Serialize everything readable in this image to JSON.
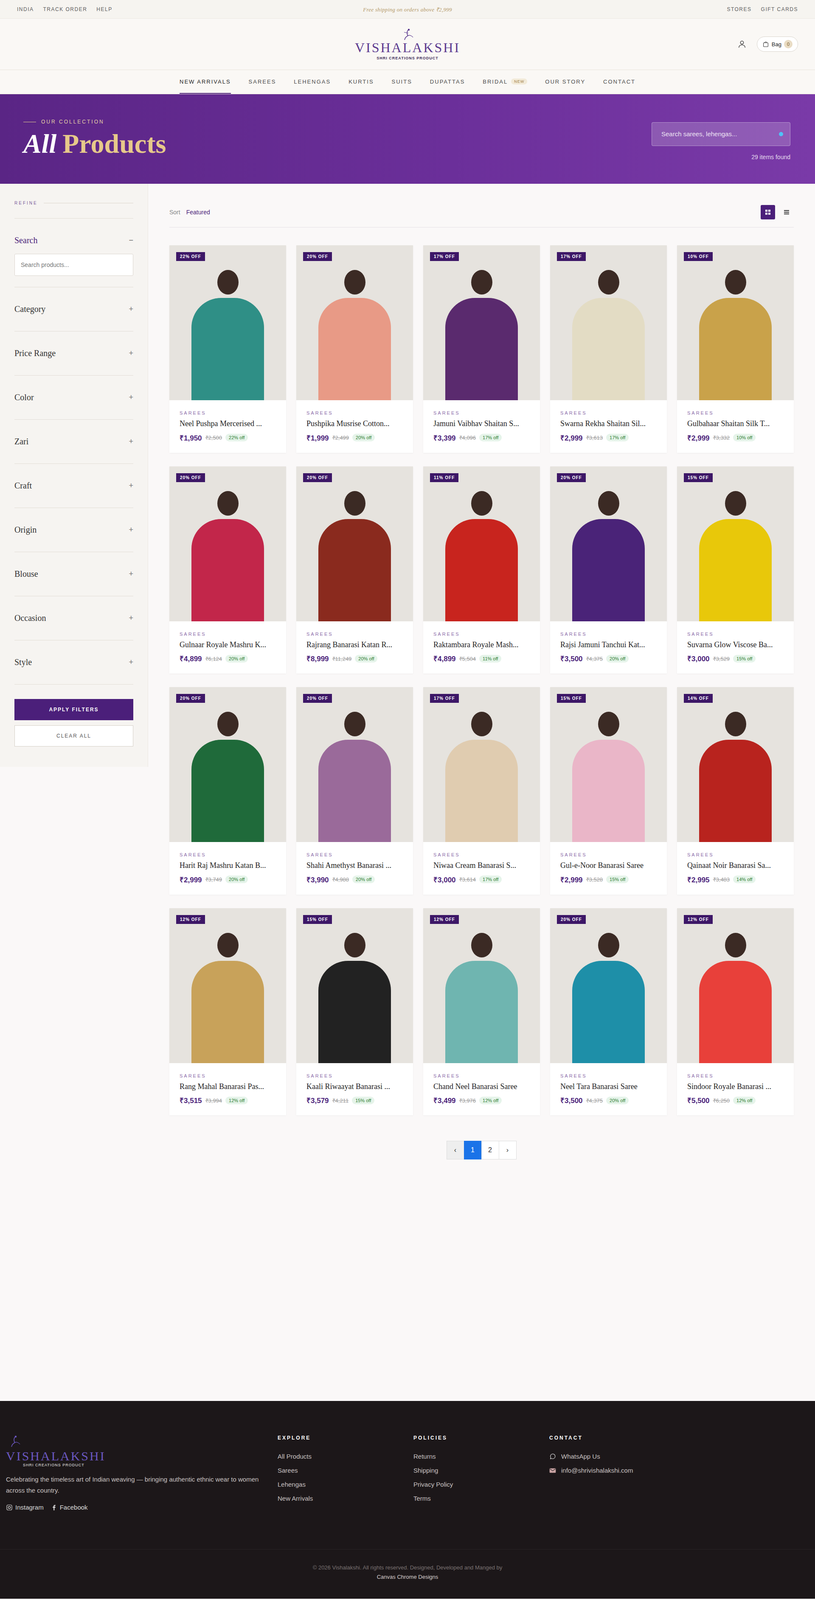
{
  "topbar": {
    "left": [
      "INDIA",
      "TRACK ORDER",
      "HELP"
    ],
    "promo": "Free shipping on orders above ₹2,999",
    "right": [
      "STORES",
      "GIFT CARDS"
    ]
  },
  "header": {
    "logo": "VISHALAKSHI",
    "tagline": "SHRI CREATIONS PRODUCT",
    "bag_label": "Bag",
    "bag_count": "0"
  },
  "nav": [
    {
      "label": "NEW ARRIVALS",
      "selected": true
    },
    {
      "label": "SAREES",
      "selected": false
    },
    {
      "label": "LEHENGAS",
      "selected": false
    },
    {
      "label": "KURTIS",
      "selected": false
    },
    {
      "label": "SUITS",
      "selected": false
    },
    {
      "label": "DUPATTAS",
      "selected": false
    },
    {
      "label": "BRIDAL",
      "selected": false,
      "badge": "NEW"
    },
    {
      "label": "OUR STORY",
      "selected": false
    },
    {
      "label": "CONTACT",
      "selected": false
    }
  ],
  "hero": {
    "eyebrow": "OUR COLLECTION",
    "title_italic": "All",
    "title_rest": "Products",
    "search_placeholder": "Search sarees, lehengas...",
    "count": "29 items found"
  },
  "sidebar": {
    "heading": "REFINE",
    "sections": [
      {
        "label": "Search",
        "expanded": true,
        "toggle": "−",
        "placeholder": "Search products..."
      },
      {
        "label": "Category",
        "expanded": false,
        "toggle": "+"
      },
      {
        "label": "Price Range",
        "expanded": false,
        "toggle": "+"
      },
      {
        "label": "Color",
        "expanded": false,
        "toggle": "+"
      },
      {
        "label": "Zari",
        "expanded": false,
        "toggle": "+"
      },
      {
        "label": "Craft",
        "expanded": false,
        "toggle": "+"
      },
      {
        "label": "Origin",
        "expanded": false,
        "toggle": "+"
      },
      {
        "label": "Blouse",
        "expanded": false,
        "toggle": "+"
      },
      {
        "label": "Occasion",
        "expanded": false,
        "toggle": "+"
      },
      {
        "label": "Style",
        "expanded": false,
        "toggle": "+"
      }
    ],
    "apply": "APPLY FILTERS",
    "clear": "CLEAR ALL"
  },
  "toolbar": {
    "sort_label": "Sort",
    "sort_value": "Featured",
    "views": [
      {
        "kind": "grid",
        "selected": true
      },
      {
        "kind": "list",
        "selected": false
      }
    ]
  },
  "products": [
    {
      "badge": "22% OFF",
      "category": "SAREES",
      "name": "Neel Pushpa Mercerised ...",
      "price": "₹1,950",
      "old_price": "₹2,500",
      "off": "22% off",
      "color": "#2f8f86"
    },
    {
      "badge": "20% OFF",
      "category": "SAREES",
      "name": "Pushpika Musrise Cotton...",
      "price": "₹1,999",
      "old_price": "₹2,499",
      "off": "20% off",
      "color": "#e89a86"
    },
    {
      "badge": "17% OFF",
      "category": "SAREES",
      "name": "Jamuni Vaibhav Shaitan S...",
      "price": "₹3,399",
      "old_price": "₹4,096",
      "off": "17% off",
      "color": "#5a2a6e"
    },
    {
      "badge": "17% OFF",
      "category": "SAREES",
      "name": "Swarna Rekha Shaitan Sil...",
      "price": "₹2,999",
      "old_price": "₹3,613",
      "off": "17% off",
      "color": "#e3dcc4"
    },
    {
      "badge": "10% OFF",
      "category": "SAREES",
      "name": "Gulbahaar Shaitan Silk T...",
      "price": "₹2,999",
      "old_price": "₹3,332",
      "off": "10% off",
      "color": "#c9a24a"
    },
    {
      "badge": "20% OFF",
      "category": "SAREES",
      "name": "Gulnaar Royale Mashru K...",
      "price": "₹4,899",
      "old_price": "₹6,124",
      "off": "20% off",
      "color": "#c2264a"
    },
    {
      "badge": "20% OFF",
      "category": "SAREES",
      "name": "Rajrang Banarasi Katan R...",
      "price": "₹8,999",
      "old_price": "₹11,249",
      "off": "20% off",
      "color": "#8a2a1e"
    },
    {
      "badge": "11% OFF",
      "category": "SAREES",
      "name": "Raktambara Royale Mash...",
      "price": "₹4,899",
      "old_price": "₹5,504",
      "off": "11% off",
      "color": "#c8241e"
    },
    {
      "badge": "20% OFF",
      "category": "SAREES",
      "name": "Rajsi Jamuni Tanchui Kat...",
      "price": "₹3,500",
      "old_price": "₹4,375",
      "off": "20% off",
      "color": "#4a2378"
    },
    {
      "badge": "15% OFF",
      "category": "SAREES",
      "name": "Suvarna Glow Viscose Ba...",
      "price": "₹3,000",
      "old_price": "₹3,529",
      "off": "15% off",
      "color": "#e8c80a"
    },
    {
      "badge": "20% OFF",
      "category": "SAREES",
      "name": "Harit Raj Mashru Katan B...",
      "price": "₹2,999",
      "old_price": "₹3,749",
      "off": "20% off",
      "color": "#1f6a3a"
    },
    {
      "badge": "20% OFF",
      "category": "SAREES",
      "name": "Shahi Amethyst Banarasi ...",
      "price": "₹3,990",
      "old_price": "₹4,988",
      "off": "20% off",
      "color": "#9a6a9a"
    },
    {
      "badge": "17% OFF",
      "category": "SAREES",
      "name": "Niwaa Cream Banarasi S...",
      "price": "₹3,000",
      "old_price": "₹3,614",
      "off": "17% off",
      "color": "#e0ccb0"
    },
    {
      "badge": "15% OFF",
      "category": "SAREES",
      "name": "Gul-e-Noor Banarasi Saree",
      "price": "₹2,999",
      "old_price": "₹3,528",
      "off": "15% off",
      "color": "#eab6c8"
    },
    {
      "badge": "14% OFF",
      "category": "SAREES",
      "name": "Qainaat Noir Banarasi Sa...",
      "price": "₹2,995",
      "old_price": "₹3,483",
      "off": "14% off",
      "color": "#b8231e"
    },
    {
      "badge": "12% OFF",
      "category": "SAREES",
      "name": "Rang Mahal Banarasi Pas...",
      "price": "₹3,515",
      "old_price": "₹3,994",
      "off": "12% off",
      "color": "#c8a25a"
    },
    {
      "badge": "15% OFF",
      "category": "SAREES",
      "name": "Kaali Riwaayat Banarasi ...",
      "price": "₹3,579",
      "old_price": "₹4,211",
      "off": "15% off",
      "color": "#222222"
    },
    {
      "badge": "12% OFF",
      "category": "SAREES",
      "name": "Chand Neel Banarasi Saree",
      "price": "₹3,499",
      "old_price": "₹3,976",
      "off": "12% off",
      "color": "#6fb5b0"
    },
    {
      "badge": "20% OFF",
      "category": "SAREES",
      "name": "Neel Tara Banarasi Saree",
      "price": "₹3,500",
      "old_price": "₹4,375",
      "off": "20% off",
      "color": "#1e8fa8"
    },
    {
      "badge": "12% OFF",
      "category": "SAREES",
      "name": "Sindoor Royale Banarasi ...",
      "price": "₹5,500",
      "old_price": "₹6,250",
      "off": "12% off",
      "color": "#e8403a"
    }
  ],
  "pagination": {
    "prev": "‹",
    "next": "›",
    "pages": [
      {
        "label": "1",
        "selected": true
      },
      {
        "label": "2",
        "selected": false
      }
    ]
  },
  "footer": {
    "logo": "VISHALAKSHI",
    "tagline": "SHRI CREATIONS PRODUCT",
    "description": "Celebrating the timeless art of Indian weaving — bringing authentic ethnic wear to women across the country.",
    "social": [
      {
        "kind": "instagram",
        "label": "Instagram"
      },
      {
        "kind": "facebook",
        "label": "Facebook"
      }
    ],
    "columns": [
      {
        "title": "EXPLORE",
        "links": [
          "All Products",
          "Sarees",
          "Lehengas",
          "New Arrivals"
        ]
      },
      {
        "title": "POLICIES",
        "links": [
          "Returns",
          "Shipping",
          "Privacy Policy",
          "Terms"
        ]
      }
    ],
    "contact_title": "CONTACT",
    "contact": [
      {
        "kind": "whatsapp",
        "label": "WhatsApp Us"
      },
      {
        "kind": "mail",
        "label": "info@shrivishalakshi.com"
      }
    ],
    "copyright": "© 2026 Vishalakshi. All rights reserved. Designed, Developed and Manged by",
    "credit": "Canvas Chrome Designs"
  }
}
